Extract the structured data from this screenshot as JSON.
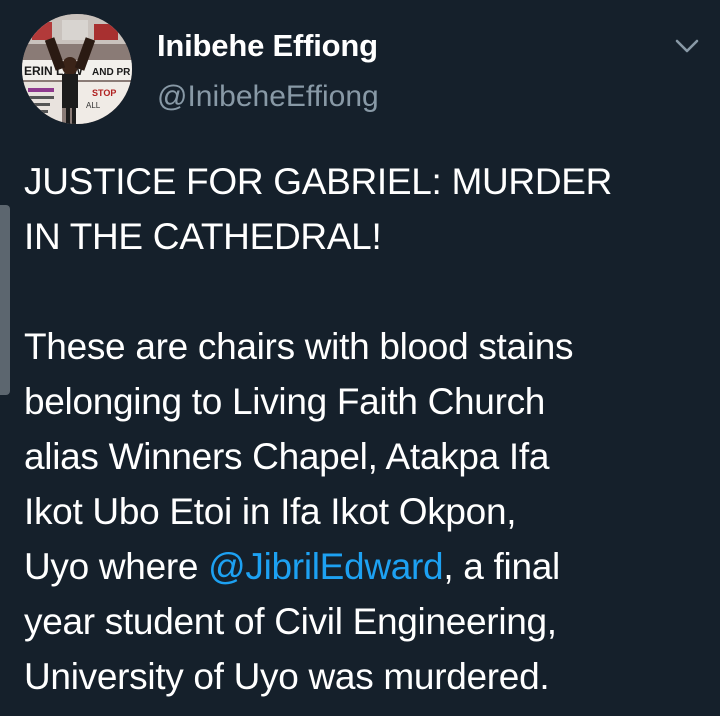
{
  "author": {
    "display_name": "Inibehe Effiong",
    "handle": "@InibeheEffiong"
  },
  "avatar": {
    "sign_texts": [
      "ERIN LAW",
      "AND PR",
      "STOP",
      "ALL"
    ]
  },
  "tweet": {
    "paragraph_1": "JUSTICE FOR GABRIEL: MURDER\nIN THE CATHEDRAL!",
    "paragraph_2_before": "These are chairs with blood stains\nbelonging to Living Faith Church\nalias Winners Chapel, Atakpa Ifa\nIkot Ubo Etoi in Ifa Ikot Okpon,\nUyo where ",
    "mention": "@JibrilEdward",
    "paragraph_2_after": ", a final\nyear student of Civil Engineering,\nUniversity of Uyo was murdered."
  },
  "icons": {
    "menu": "chevron-down-icon"
  },
  "colors": {
    "background": "#15202b",
    "text": "#ffffff",
    "secondary_text": "#8899a6",
    "link": "#1da1f2"
  }
}
